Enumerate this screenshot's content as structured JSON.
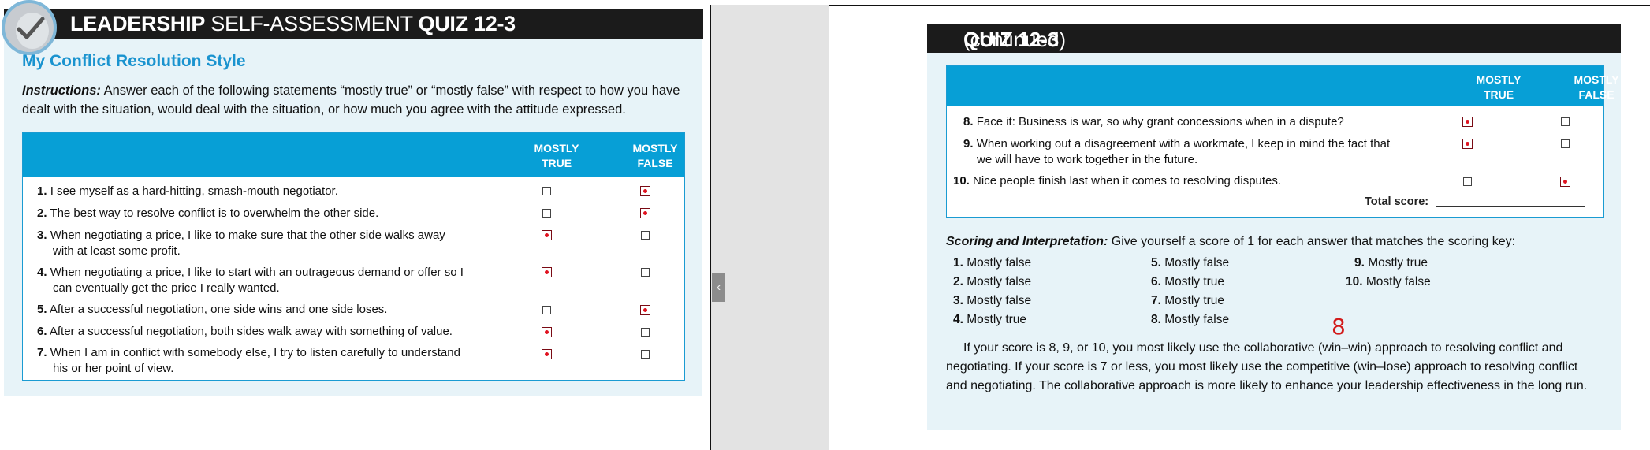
{
  "left": {
    "title": {
      "part1": "LEADERSHIP",
      "part2": " SELF-ASSESSMENT ",
      "part3": "QUIZ 12-3"
    },
    "subtitle": "My Conflict Resolution Style",
    "instructions": {
      "label": "Instructions:",
      "text": " Answer each of the following statements “mostly true” or “mostly false” with respect to how you have dealt with the situation, would deal with the situation, or how much you agree with the attitude expressed."
    },
    "columns": {
      "true_line1": "MOSTLY",
      "true_line2": "TRUE",
      "false_line1": "MOSTLY",
      "false_line2": "FALSE"
    },
    "questions": [
      {
        "num": "1.",
        "line1": "I see myself as a hard-hitting, smash-mouth negotiator.",
        "line2": "",
        "answer": "false"
      },
      {
        "num": "2.",
        "line1": "The best way to resolve conflict is to overwhelm the other side.",
        "line2": "",
        "answer": "false"
      },
      {
        "num": "3.",
        "line1": "When negotiating a price, I like to make sure that the other side walks away",
        "line2": "with at least some profit.",
        "answer": "true"
      },
      {
        "num": "4.",
        "line1": "When negotiating a price, I like to start with an outrageous demand or offer so I",
        "line2": "can eventually get the price I really wanted.",
        "answer": "true"
      },
      {
        "num": "5.",
        "line1": "After a successful negotiation, one side wins and one side loses.",
        "line2": "",
        "answer": "false"
      },
      {
        "num": "6.",
        "line1": "After a successful negotiation, both sides walk away with something of value.",
        "line2": "",
        "answer": "true"
      },
      {
        "num": "7.",
        "line1": "When I am in conflict with somebody else, I try to listen carefully to understand",
        "line2": "his or her point of view.",
        "answer": "true"
      }
    ]
  },
  "right": {
    "title": {
      "part1": "QUIZ 12-3",
      "part2": " (continued)"
    },
    "columns": {
      "true_line1": "MOSTLY",
      "true_line2": "TRUE",
      "false_line1": "MOSTLY",
      "false_line2": "FALSE"
    },
    "questions": [
      {
        "num": "8.",
        "line1": "Face it: Business is war, so why grant concessions when in a dispute?",
        "line2": "",
        "answer": "true"
      },
      {
        "num": "9.",
        "line1": "When working out a disagreement with a workmate, I keep in mind the fact that",
        "line2": "we will have to work together in the future.",
        "answer": "true"
      },
      {
        "num": "10.",
        "line1": "Nice people finish last when it comes to resolving disputes.",
        "line2": "",
        "answer": "false"
      }
    ],
    "total_label": "Total score:",
    "scoring": {
      "label": "Scoring and Interpretation:",
      "text": " Give yourself a score of 1 for each answer that matches the scoring key:"
    },
    "key": [
      {
        "num": "1.",
        "text": " Mostly false"
      },
      {
        "num": "2.",
        "text": " Mostly false"
      },
      {
        "num": "3.",
        "text": " Mostly false"
      },
      {
        "num": "4.",
        "text": " Mostly true"
      },
      {
        "num": "5.",
        "text": " Mostly false"
      },
      {
        "num": "6.",
        "text": " Mostly true"
      },
      {
        "num": "7.",
        "text": " Mostly true"
      },
      {
        "num": "8.",
        "text": " Mostly false"
      },
      {
        "num": "9.",
        "text": " Mostly true"
      },
      {
        "num": "10.",
        "text": " Mostly false"
      }
    ],
    "handwritten_score": "8",
    "interpretation": "If your score is 8, 9, or 10, you most likely use the collaborative (win–win) approach to resolving conflict and negotiating. If your score is 7 or less, you most likely use the competitive (win–lose) approach to resolving conflict and negotiating. The collaborative approach is more likely to enhance your leadership effectiveness in the long run."
  },
  "viewer": {
    "collapse_icon": "chevron-left-icon",
    "collapse_glyph": "‹"
  },
  "colors": {
    "accent": "#079fd6",
    "panel": "#e7f3f8",
    "titlebar": "#1b1b1b",
    "check": "#e0121f",
    "handwriting": "#d21a1a"
  }
}
